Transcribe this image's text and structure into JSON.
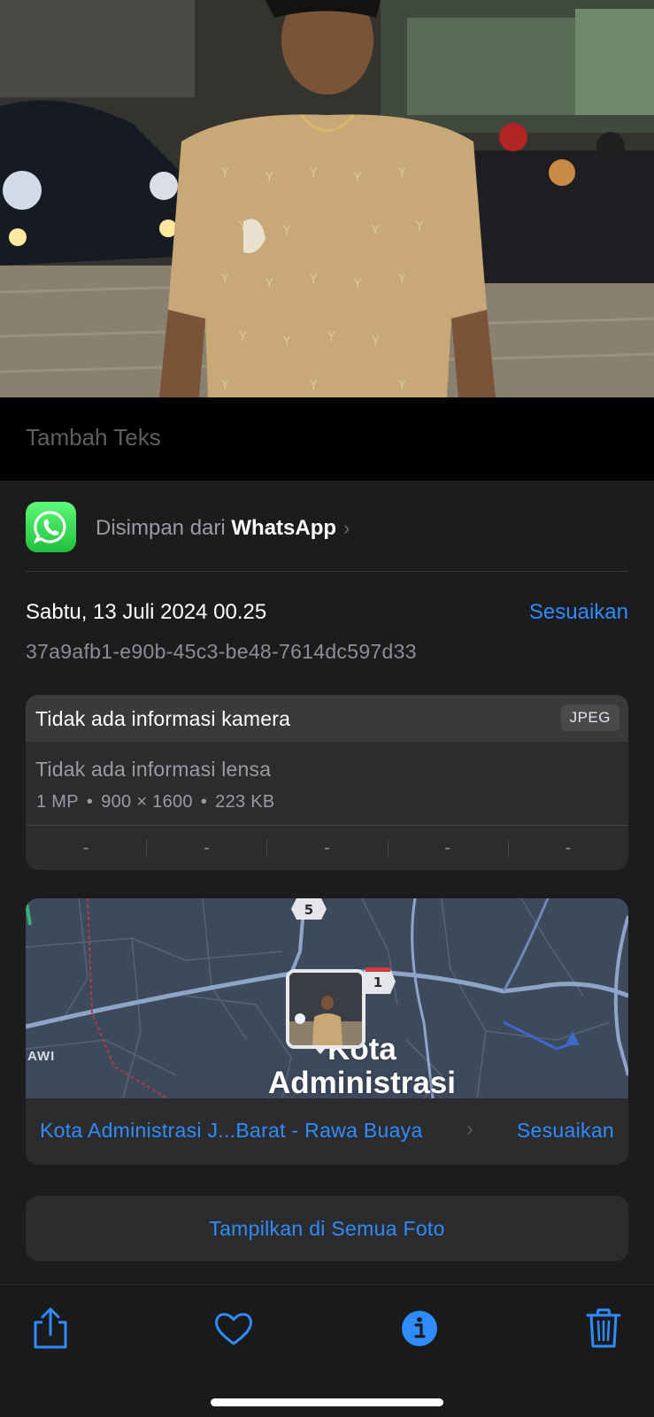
{
  "caption": {
    "placeholder": "Tambah Teks"
  },
  "source": {
    "prefix": "Disimpan dari",
    "app": "WhatsApp",
    "chevron": "›",
    "icon": "whatsapp-icon"
  },
  "meta": {
    "date": "Sabtu, 13 Juli 2024 00.25",
    "adjust_label": "Sesuaikan",
    "file_id": "37a9afb1-e90b-45c3-be48-7614dc597d33"
  },
  "camera": {
    "title": "Tidak ada informasi kamera",
    "format": "JPEG",
    "lens": "Tidak ada informasi lensa",
    "megapixels": "1 MP",
    "dimensions": "900 × 1600",
    "size": "223 KB",
    "separator": "•",
    "exif": [
      "-",
      "-",
      "-",
      "-",
      "-"
    ]
  },
  "map": {
    "city_label": "Kota\nAdministrasi",
    "edge_label": "AWI",
    "road_markers": [
      "5",
      "1"
    ],
    "location": "Kota Administrasi J...Barat - Rawa Buaya",
    "chevron": "›",
    "adjust_label": "Sesuaikan"
  },
  "show_all_label": "Tampilkan di Semua Foto",
  "toolbar": {
    "icons": [
      "share-icon",
      "heart-icon",
      "info-icon",
      "trash-icon"
    ]
  },
  "colors": {
    "accent": "#2f8cff",
    "background": "#1c1c1e",
    "card": "#2c2c2e",
    "whatsapp": "#25d366"
  }
}
